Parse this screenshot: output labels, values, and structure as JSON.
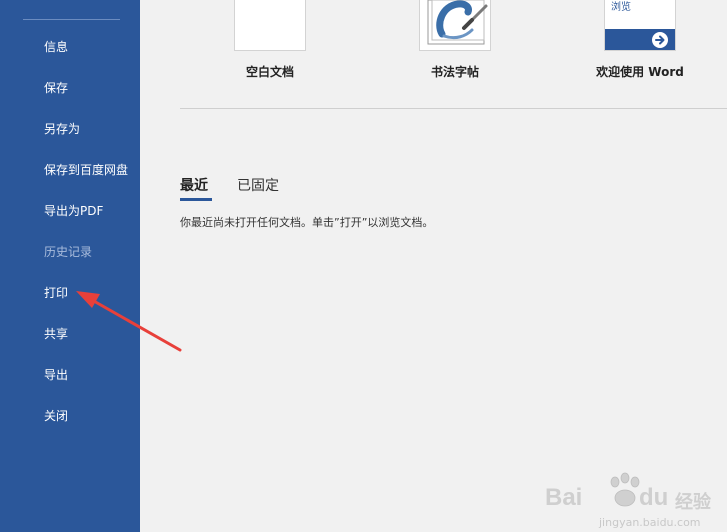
{
  "sidebar": {
    "items": [
      {
        "label": "信息",
        "enabled": true
      },
      {
        "label": "保存",
        "enabled": true
      },
      {
        "label": "另存为",
        "enabled": true
      },
      {
        "label": "保存到百度网盘",
        "enabled": true
      },
      {
        "label": "导出为PDF",
        "enabled": true
      },
      {
        "label": "历史记录",
        "enabled": false
      },
      {
        "label": "打印",
        "enabled": true
      },
      {
        "label": "共享",
        "enabled": true
      },
      {
        "label": "导出",
        "enabled": true
      },
      {
        "label": "关闭",
        "enabled": true
      }
    ]
  },
  "templates": [
    {
      "label": "空白文档",
      "icon": "blank-document-thumbnail"
    },
    {
      "label": "书法字帖",
      "icon": "calligraphy-brush-thumbnail"
    },
    {
      "label": "欢迎使用 Word",
      "icon": "welcome-word-thumbnail",
      "thumb_text": "浏览"
    }
  ],
  "tabs": [
    {
      "label": "最近",
      "active": true
    },
    {
      "label": "已固定",
      "active": false
    }
  ],
  "recent_empty_message": "你最近尚未打开任何文档。单击”打开”以浏览文档。",
  "watermark": {
    "brand": "Bai",
    "brand_tail": "du",
    "product": "经验",
    "url": "jingyan.baidu.com"
  },
  "colors": {
    "sidebar_bg": "#2b579a",
    "main_bg": "#f1f1f1",
    "annotation_arrow": "#e8403a"
  }
}
